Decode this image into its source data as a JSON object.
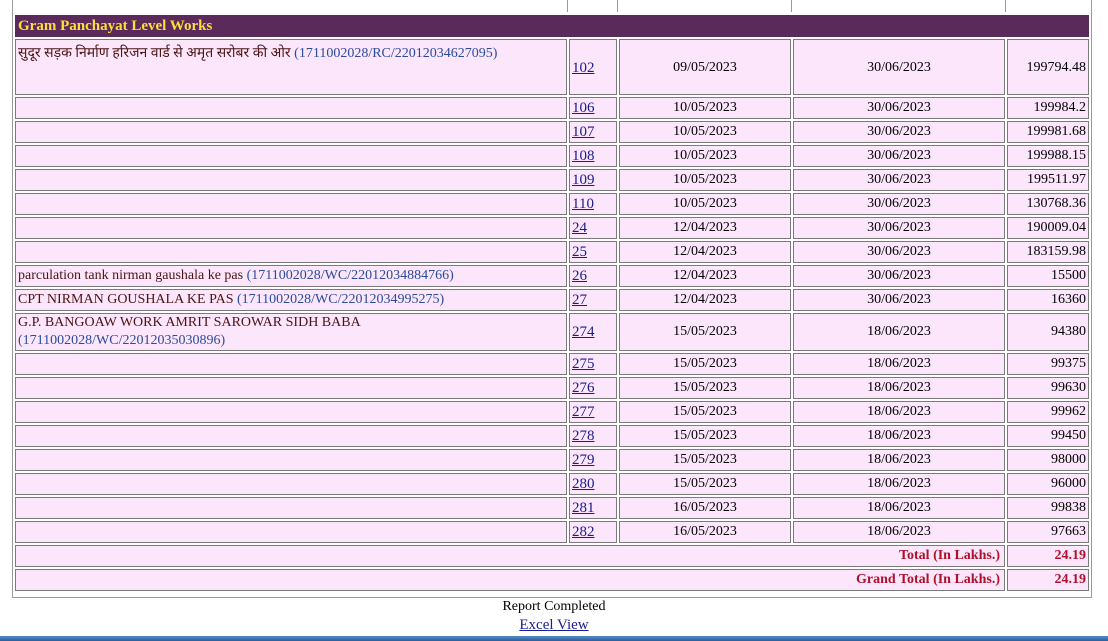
{
  "section_title": "Gram Panchayat Level Works",
  "rows": [
    {
      "name": "सुदूर सड़क निर्माण हरिजन वार्ड से अमृत सरोबर की ओर",
      "code": "(1711002028/RC/22012034627095)",
      "id": "102",
      "d1": "09/05/2023",
      "d2": "30/06/2023",
      "amt": "199794.48"
    },
    {
      "name": "",
      "code": "",
      "id": "106",
      "d1": "10/05/2023",
      "d2": "30/06/2023",
      "amt": "199984.2"
    },
    {
      "name": "",
      "code": "",
      "id": "107",
      "d1": "10/05/2023",
      "d2": "30/06/2023",
      "amt": "199981.68"
    },
    {
      "name": "",
      "code": "",
      "id": "108",
      "d1": "10/05/2023",
      "d2": "30/06/2023",
      "amt": "199988.15"
    },
    {
      "name": "",
      "code": "",
      "id": "109",
      "d1": "10/05/2023",
      "d2": "30/06/2023",
      "amt": "199511.97"
    },
    {
      "name": "",
      "code": "",
      "id": "110",
      "d1": "10/05/2023",
      "d2": "30/06/2023",
      "amt": "130768.36"
    },
    {
      "name": "",
      "code": "",
      "id": "24",
      "d1": "12/04/2023",
      "d2": "30/06/2023",
      "amt": "190009.04"
    },
    {
      "name": "",
      "code": "",
      "id": "25",
      "d1": "12/04/2023",
      "d2": "30/06/2023",
      "amt": "183159.98"
    },
    {
      "name": "parculation tank nirman gaushala ke pas",
      "code": "(1711002028/WC/22012034884766)",
      "id": "26",
      "d1": "12/04/2023",
      "d2": "30/06/2023",
      "amt": "15500"
    },
    {
      "name": "CPT NIRMAN GOUSHALA KE PAS",
      "code": "(1711002028/WC/22012034995275)",
      "id": "27",
      "d1": "12/04/2023",
      "d2": "30/06/2023",
      "amt": "16360"
    },
    {
      "name": "G.P. BANGOAW WORK AMRIT SAROWAR SIDH BABA",
      "code": "(1711002028/WC/22012035030896)",
      "id": "274",
      "d1": "15/05/2023",
      "d2": "18/06/2023",
      "amt": "94380"
    },
    {
      "name": "",
      "code": "",
      "id": "275",
      "d1": "15/05/2023",
      "d2": "18/06/2023",
      "amt": "99375"
    },
    {
      "name": "",
      "code": "",
      "id": "276",
      "d1": "15/05/2023",
      "d2": "18/06/2023",
      "amt": "99630"
    },
    {
      "name": "",
      "code": "",
      "id": "277",
      "d1": "15/05/2023",
      "d2": "18/06/2023",
      "amt": "99962"
    },
    {
      "name": "",
      "code": "",
      "id": "278",
      "d1": "15/05/2023",
      "d2": "18/06/2023",
      "amt": "99450"
    },
    {
      "name": "",
      "code": "",
      "id": "279",
      "d1": "15/05/2023",
      "d2": "18/06/2023",
      "amt": "98000"
    },
    {
      "name": "",
      "code": "",
      "id": "280",
      "d1": "15/05/2023",
      "d2": "18/06/2023",
      "amt": "96000"
    },
    {
      "name": "",
      "code": "",
      "id": "281",
      "d1": "16/05/2023",
      "d2": "18/06/2023",
      "amt": "99838"
    },
    {
      "name": "",
      "code": "",
      "id": "282",
      "d1": "16/05/2023",
      "d2": "18/06/2023",
      "amt": "97663"
    }
  ],
  "total": {
    "label": "Total (In Lakhs.)",
    "value": "24.19"
  },
  "grand_total": {
    "label": "Grand Total (In Lakhs.)",
    "value": "24.19"
  },
  "footer": {
    "status": "Report Completed",
    "excel_link": "Excel View"
  }
}
